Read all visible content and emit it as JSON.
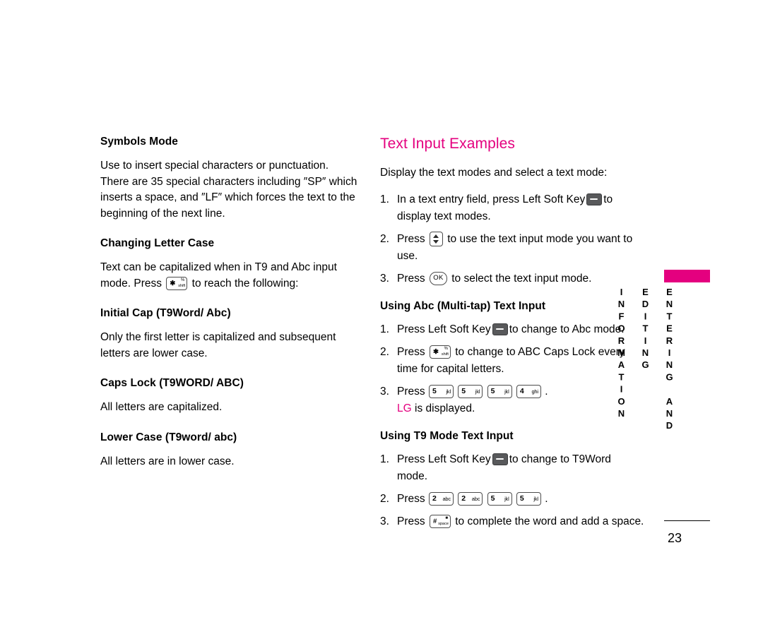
{
  "left_column": {
    "symbols_mode": {
      "heading": "Symbols Mode",
      "body": "Use to insert special characters or punctuation. There are 35 special characters including ″SP″ which inserts a space, and ″LF″ which forces the text to the beginning of the next line."
    },
    "changing_letter_case": {
      "heading": "Changing Letter Case",
      "body_part1": "Text can be capitalized when in T9 and Abc input mode. Press",
      "body_part2": "to reach the following:",
      "key": {
        "glyph": "✱",
        "label_top": "%",
        "label_bottom": "shift"
      }
    },
    "initial_cap": {
      "heading": "Initial Cap (T9Word/ Abc)",
      "body": "Only the first letter is capitalized and subsequent letters are lower case."
    },
    "caps_lock": {
      "heading": "Caps Lock (T9WORD/ ABC)",
      "body": "All letters are capitalized."
    },
    "lower_case": {
      "heading": "Lower Case (T9word/ abc)",
      "body": "All letters are in lower case."
    }
  },
  "right_column": {
    "title": "Text Input Examples",
    "intro": "Display the text modes and select a text mode:",
    "main_steps": [
      {
        "num": "1.",
        "before": "In a text entry field, press Left Soft Key",
        "key": "soft-key",
        "after": "to",
        "second_line": "display text modes."
      },
      {
        "num": "2.",
        "before": "Press",
        "key": "nav-up-down-key",
        "after": "to use the text input mode you want to",
        "second_line": "use."
      },
      {
        "num": "3.",
        "before": "Press",
        "key": "ok-key",
        "after": "to select the text input mode.",
        "second_line": ""
      }
    ],
    "abc_section": {
      "heading": "Using Abc (Multi-tap) Text Input",
      "steps": [
        {
          "num": "1.",
          "before": "Press Left Soft Key",
          "after": "to change to Abc mode."
        },
        {
          "num": "2.",
          "before": "Press",
          "after": "to change to ABC Caps Lock every",
          "second_line": "time for capital letters."
        },
        {
          "num": "3.",
          "before": "Press",
          "after": ".",
          "keys": [
            {
              "digit": "5",
              "label": "jkl"
            },
            {
              "digit": "5",
              "label": "jkl"
            },
            {
              "digit": "5",
              "label": "jkl"
            },
            {
              "digit": "4",
              "label": "ghi"
            }
          ],
          "result_mark": "LG",
          "result_text": "is displayed."
        }
      ]
    },
    "t9_section": {
      "heading": "Using T9 Mode Text Input",
      "steps": [
        {
          "num": "1.",
          "before": "Press Left Soft Key",
          "after": "to change to T9Word",
          "second_line": "mode."
        },
        {
          "num": "2.",
          "before": "Press",
          "after": ".",
          "keys": [
            {
              "digit": "2",
              "label": "abc"
            },
            {
              "digit": "2",
              "label": "abc"
            },
            {
              "digit": "5",
              "label": "jkl"
            },
            {
              "digit": "5",
              "label": "jkl"
            }
          ]
        },
        {
          "num": "3.",
          "before": "Press",
          "after": "to complete the word and add a space.",
          "key": {
            "glyph": "#",
            "label_top": "■",
            "label_bottom": "space"
          }
        }
      ]
    }
  },
  "side_tab": {
    "text": "ENTERING AND EDITING INFORMATION",
    "accent_color": "#e4007f"
  },
  "page_number": "23"
}
